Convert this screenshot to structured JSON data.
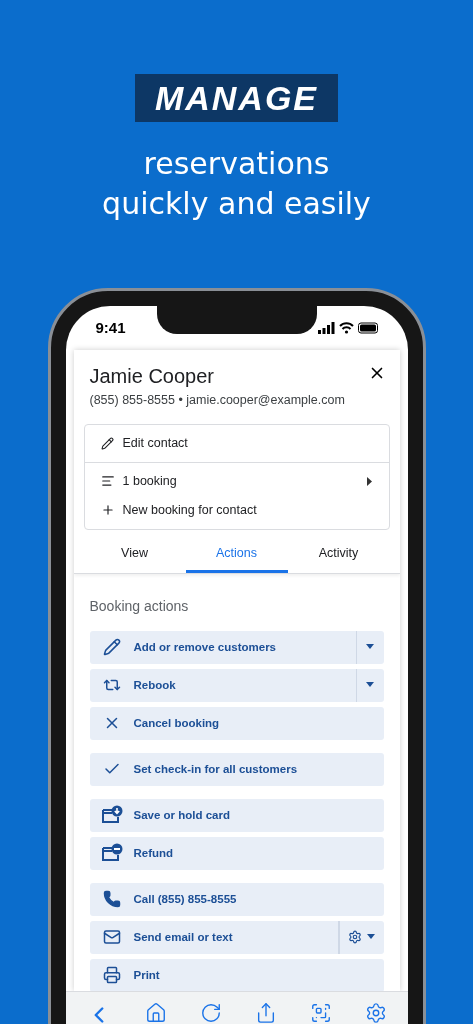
{
  "headline": {
    "badge": "MANAGE",
    "lines": [
      "reservations",
      "quickly and easily"
    ]
  },
  "status_bar": {
    "time": "9:41"
  },
  "contact": {
    "name": "Jamie Cooper",
    "details": "(855) 855-8555 • jamie.cooper@example.com"
  },
  "contact_menu": [
    {
      "label": "Edit contact",
      "kind": "plain"
    },
    {
      "label": "1 booking",
      "kind": "submenu"
    },
    {
      "label": "New booking for contact",
      "kind": "plain"
    }
  ],
  "tabs": [
    {
      "label": "View",
      "selected": false
    },
    {
      "label": "Actions",
      "selected": true
    },
    {
      "label": "Activity",
      "selected": false
    }
  ],
  "section_title": "Booking actions",
  "action_groups": [
    [
      {
        "label": "Add or remove customers",
        "kind": "split"
      },
      {
        "label": "Rebook",
        "kind": "split"
      },
      {
        "label": "Cancel booking",
        "kind": "simple"
      }
    ],
    [
      {
        "label": "Set check-in for all customers",
        "kind": "simple"
      }
    ],
    [
      {
        "label": "Save or hold card",
        "kind": "simple"
      },
      {
        "label": "Refund",
        "kind": "simple"
      }
    ],
    [
      {
        "label": "Call (855) 855-8555",
        "kind": "simple"
      },
      {
        "label": "Send email or text",
        "kind": "settings"
      },
      {
        "label": "Print",
        "kind": "simple"
      }
    ]
  ]
}
